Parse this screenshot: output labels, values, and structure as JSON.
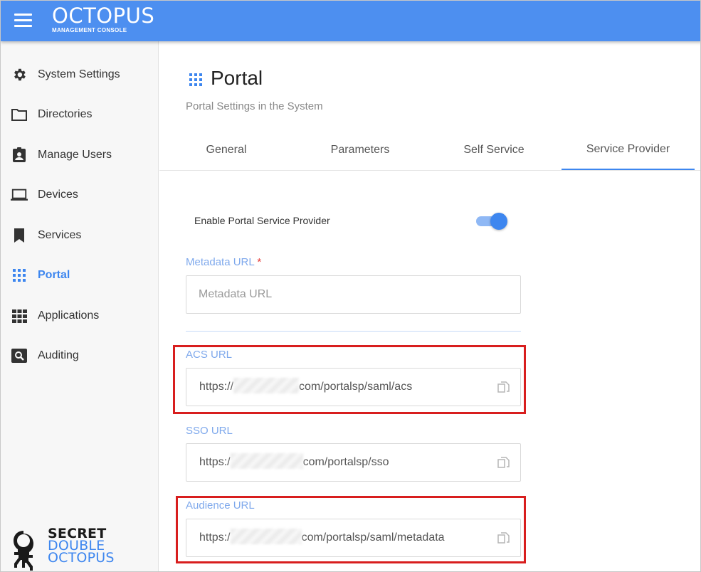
{
  "header": {
    "brand_title": "OCTOPUS",
    "brand_subtitle": "MANAGEMENT CONSOLE",
    "color": "#4d8ff0"
  },
  "sidebar": {
    "items": [
      {
        "label": "System Settings",
        "icon": "gear-icon",
        "active": false
      },
      {
        "label": "Directories",
        "icon": "folder-icon",
        "active": false
      },
      {
        "label": "Manage Users",
        "icon": "user-badge-icon",
        "active": false
      },
      {
        "label": "Devices",
        "icon": "laptop-icon",
        "active": false
      },
      {
        "label": "Services",
        "icon": "bookmark-icon",
        "active": false
      },
      {
        "label": "Portal",
        "icon": "grid-icon",
        "active": true
      },
      {
        "label": "Applications",
        "icon": "apps-icon",
        "active": false
      },
      {
        "label": "Auditing",
        "icon": "search-box-icon",
        "active": false
      }
    ],
    "logo_lines": [
      "SECRET",
      "DOUBLE",
      "OCTOPUS"
    ]
  },
  "page": {
    "title": "Portal",
    "subtitle": "Portal Settings in the System",
    "accent": "#3d86ef"
  },
  "tabs": [
    {
      "label": "General",
      "active": false
    },
    {
      "label": "Parameters",
      "active": false
    },
    {
      "label": "Self Service",
      "active": false
    },
    {
      "label": "Service Provider",
      "active": true
    }
  ],
  "service_provider": {
    "enable_label": "Enable Portal Service Provider",
    "enabled": true,
    "metadata_url": {
      "label": "Metadata URL",
      "required_mark": "*",
      "placeholder": "Metadata URL",
      "value": ""
    },
    "acs_url": {
      "label": "ACS URL",
      "prefix": "https://",
      "suffix": "com/portalsp/saml/acs"
    },
    "sso_url": {
      "label": "SSO URL",
      "prefix": "https:/",
      "suffix": "com/portalsp/sso"
    },
    "audience_url": {
      "label": "Audience URL",
      "prefix": "https:/",
      "suffix": "com/portalsp/saml/metadata"
    }
  }
}
